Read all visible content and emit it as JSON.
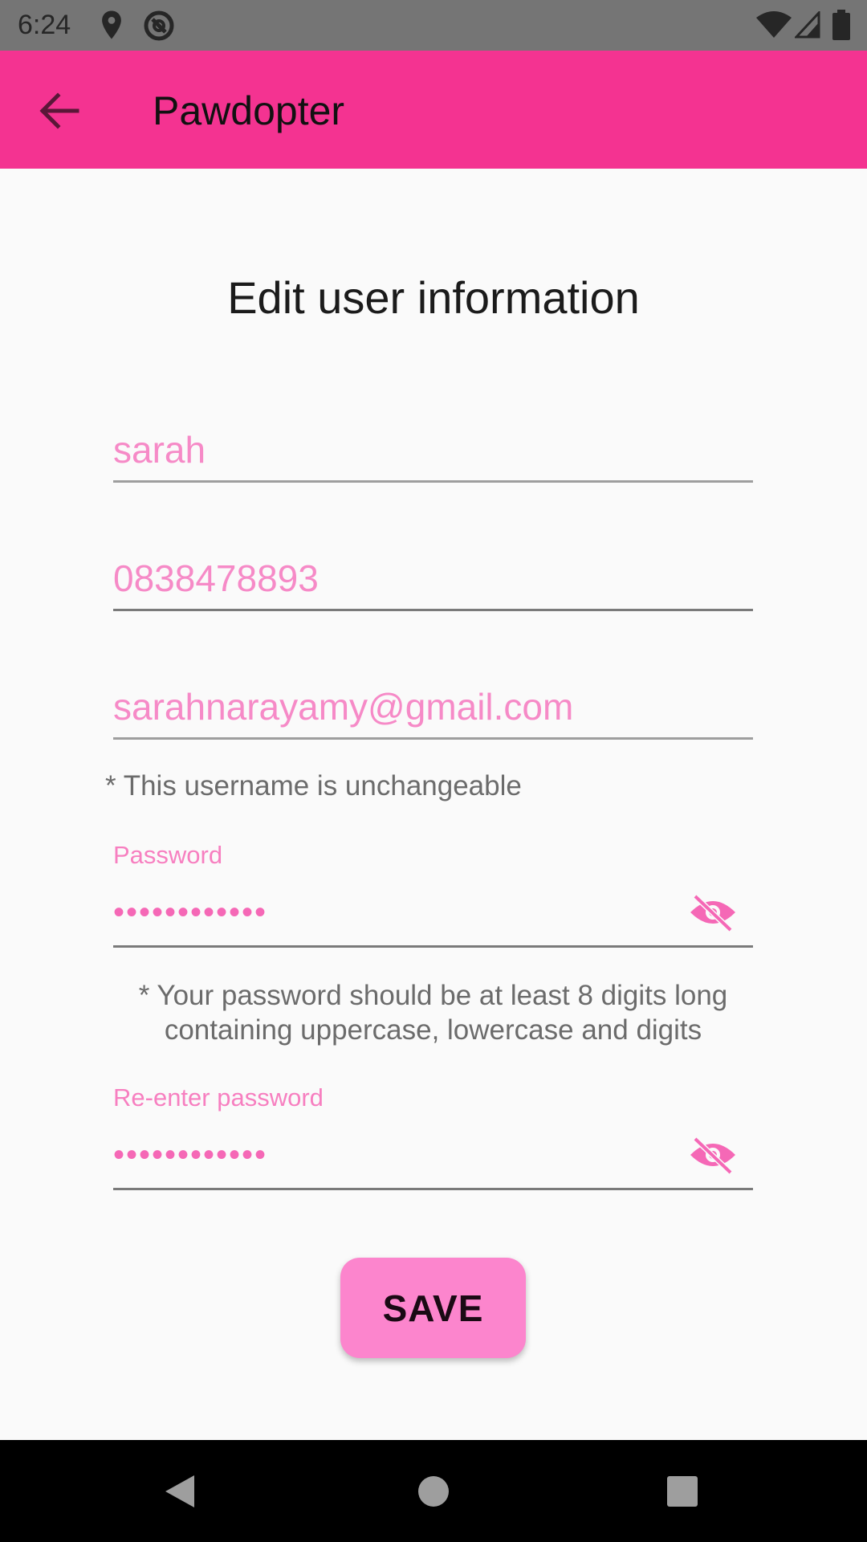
{
  "status_bar": {
    "time": "6:24",
    "icons": [
      "location-icon",
      "at-sign-icon",
      "wifi-icon",
      "signal-icon",
      "battery-icon"
    ]
  },
  "app_bar": {
    "title": "Pawdopter",
    "color": "#f43391",
    "back_icon": "arrow-back-icon"
  },
  "form": {
    "heading": "Edit user information",
    "name_value": "sarah",
    "phone_value": "0838478893",
    "email_value": "sarahnarayamy@gmail.com",
    "username_hint": "* This username is unchangeable",
    "password_label": "Password",
    "password_value": "••••••••••••",
    "password_hint": "* Your password should be at least 8 digits long containing uppercase, lowercase and digits",
    "reenter_label": "Re-enter password",
    "reenter_value": "••••••••••••",
    "visibility_icon": "visibility-off-icon",
    "accent_color": "#f68ac7"
  },
  "actions": {
    "save_label": "SAVE",
    "save_color": "#fc85cd"
  },
  "nav_bar": {
    "icons": [
      "nav-back-icon",
      "nav-home-icon",
      "nav-recents-icon"
    ]
  }
}
